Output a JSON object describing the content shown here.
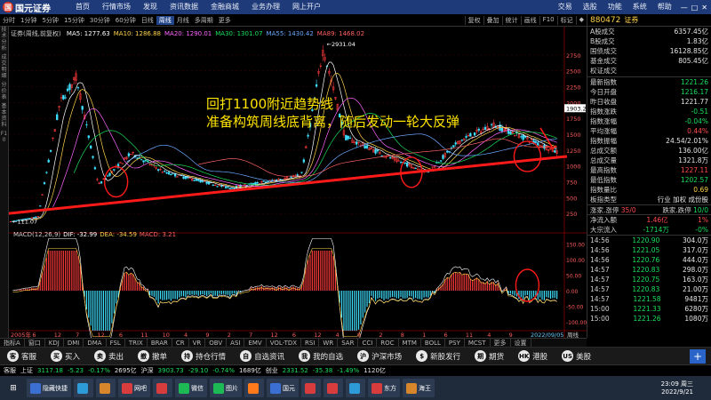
{
  "topbar": {
    "logo": "国元证券",
    "logo_mark": "国",
    "menu": [
      "首页",
      "行情市场",
      "发现",
      "资讯数据",
      "金融商城",
      "业务办理",
      "网上开户"
    ],
    "right_menu": [
      "交易",
      "选股",
      "功能",
      "系统",
      "帮助"
    ],
    "window_controls": [
      "—",
      "□",
      "✕"
    ]
  },
  "subbar": {
    "periods": [
      "分时",
      "1分钟",
      "5分钟",
      "15分钟",
      "30分钟",
      "60分钟",
      "日线",
      "周线",
      "月线",
      "多周期",
      "更多"
    ],
    "selected_period": "周线",
    "tools": [
      "复权",
      "叠加",
      "统计",
      "画线",
      "F10",
      "标记",
      "◆"
    ]
  },
  "left_strip": [
    "技术分析",
    "成交明细",
    "分价表",
    "基本资料",
    "F10"
  ],
  "chart": {
    "title": "证券(周线,前复权)",
    "ma_values": [
      {
        "label": "MA5: 1277.63",
        "color": "#ffffff"
      },
      {
        "label": "MA10: 1286.88",
        "color": "#ffd24a"
      },
      {
        "label": "MA20: 1290.01",
        "color": "#ff66ff"
      },
      {
        "label": "MA30: 1301.07",
        "color": "#18e05b"
      },
      {
        "label": "MA55: 1430.42",
        "color": "#6aa8ff"
      },
      {
        "label": "MA89: 1468.02",
        "color": "#ff6060"
      }
    ],
    "annotation_line1": "回打1100附近趋势线",
    "annotation_line2": "准备构筑周线底背离，随后发动一轮大反弹",
    "high_label": "2931.04",
    "low_label": "111.07",
    "current_value_label": "1903.2",
    "price_ticks": [
      "2750",
      "2500",
      "2250",
      "2000",
      "1750",
      "1500",
      "1250",
      "1000",
      "750",
      "500",
      "250"
    ],
    "macd_header": [
      {
        "label": "MACD(12,26,9)",
        "color": "#cccccc"
      },
      {
        "label": "DIF: -32.99",
        "color": "#ffffff"
      },
      {
        "label": "DEA: -34.59",
        "color": "#ffd24a"
      },
      {
        "label": "MACD: 3.21",
        "color": "#ff6060"
      }
    ],
    "macd_ticks": [
      "150.00",
      "100.00",
      "50.00",
      "0.00",
      "-50.00",
      "-100.00"
    ],
    "date_labels": [
      "2005年",
      "6",
      "12",
      "7",
      "12",
      "6",
      "11",
      "10",
      "4",
      "9",
      "2",
      "7",
      "12",
      "6",
      "12",
      "4",
      "9",
      "2",
      "8",
      "1",
      "6",
      "11",
      "4",
      "9",
      "2022/09/05"
    ],
    "indicator_label": "指标B",
    "week_label": "周线"
  },
  "bottom_tabs": [
    "指标A",
    "窗口",
    "KDJ",
    "DMI",
    "DMA",
    "FSL",
    "TRIX",
    "BRAR",
    "CR",
    "VR",
    "OBV",
    "ASI",
    "EMV",
    "VOL-TDX",
    "RSI",
    "WR",
    "SAR",
    "CCI",
    "ROC",
    "MTM",
    "BOLL",
    "PSY",
    "MCST",
    "更多",
    "设置"
  ],
  "right_panel": {
    "code": "880472",
    "name": "证券",
    "top_rows": [
      {
        "k": "A股成交",
        "v": "6357.45亿",
        "c": "white"
      },
      {
        "k": "B股成交",
        "v": "1.83亿",
        "c": "white"
      },
      {
        "k": "国债成交",
        "v": "16128.85亿",
        "c": "white"
      },
      {
        "k": "基金成交",
        "v": "805.45亿",
        "c": "white"
      },
      {
        "k": "权证成交",
        "v": "",
        "c": "white"
      }
    ],
    "stat_rows": [
      {
        "k": "最新指数",
        "v": "1221.26",
        "c": "green"
      },
      {
        "k": "今日开盘",
        "v": "1216.17",
        "c": "green"
      },
      {
        "k": "昨日收盘",
        "v": "1221.77",
        "c": "white"
      },
      {
        "k": "指数涨跌",
        "v": "-0.51",
        "c": "green"
      },
      {
        "k": "指数涨幅",
        "v": "-0.04%",
        "c": "green"
      },
      {
        "k": "平均涨幅",
        "v": "0.44%",
        "c": "red"
      },
      {
        "k": "指数振幅",
        "v": "24.54/2.01%",
        "c": "white"
      },
      {
        "k": "总成交额",
        "v": "136.00亿",
        "c": "white"
      },
      {
        "k": "总成交量",
        "v": "1321.8万",
        "c": "white"
      },
      {
        "k": "最高指数",
        "v": "1227.11",
        "c": "red"
      },
      {
        "k": "最低指数",
        "v": "1202.57",
        "c": "green"
      },
      {
        "k": "指数量比",
        "v": "0.69",
        "c": "yellow"
      }
    ],
    "category_row": {
      "k": "板指类型",
      "v": "行业 加权 成份股",
      "c": "white"
    },
    "updown": {
      "up_label": "涨家.涨停",
      "up": "35/0",
      "down_label": "跌家.跌停",
      "down": "10/0"
    },
    "inflow": [
      {
        "k": "净流入额",
        "v": "1.46亿",
        "p": "1%",
        "c": "red"
      },
      {
        "k": "大宗流入",
        "v": "-1714万",
        "p": "-0%",
        "c": "green"
      }
    ],
    "ticks": [
      {
        "t": "14:56",
        "p": "1220.90",
        "v": "304.0万",
        "c": "green"
      },
      {
        "t": "14:56",
        "p": "1221.05",
        "v": "317.0万",
        "c": "green"
      },
      {
        "t": "14:56",
        "p": "1220.76",
        "v": "444.0万",
        "c": "green"
      },
      {
        "t": "14:57",
        "p": "1220.83",
        "v": "298.0万",
        "c": "green"
      },
      {
        "t": "14:57",
        "p": "1220.75",
        "v": "163.0万",
        "c": "green"
      },
      {
        "t": "14:57",
        "p": "1220.83",
        "v": "21.00万",
        "c": "green"
      },
      {
        "t": "14:57",
        "p": "1221.58",
        "v": "9481万",
        "c": "green"
      },
      {
        "t": "15:00",
        "p": "1221.33",
        "v": "6280万",
        "c": "green"
      },
      {
        "t": "15:00",
        "p": "1221.26",
        "v": "1080万",
        "c": "green"
      }
    ]
  },
  "action_bar": {
    "left_items": [
      {
        "icon": "客",
        "label": "客服"
      },
      {
        "icon": "买",
        "label": "买入"
      },
      {
        "icon": "卖",
        "label": "卖出"
      },
      {
        "icon": "撤",
        "label": "撤单"
      },
      {
        "icon": "持",
        "label": "持仓行情"
      },
      {
        "icon": "自",
        "label": "自选资讯"
      },
      {
        "icon": "我",
        "label": "我的自选"
      },
      {
        "icon": "沪",
        "label": "沪深市场"
      },
      {
        "icon": "$",
        "label": "新股发行"
      },
      {
        "icon": "期",
        "label": "期货"
      },
      {
        "icon": "HK",
        "label": "港股"
      },
      {
        "icon": "US",
        "label": "美股"
      }
    ],
    "plus": "+"
  },
  "tickerbar": [
    {
      "t": "客服",
      "c": "white"
    },
    {
      "t": "上证",
      "c": "white"
    },
    {
      "t": "3117.18",
      "c": "green"
    },
    {
      "t": "-5.23",
      "c": "green"
    },
    {
      "t": "-0.17%",
      "c": "green"
    },
    {
      "t": "2695亿",
      "c": "white"
    },
    {
      "t": "沪深",
      "c": "white"
    },
    {
      "t": "3903.73",
      "c": "green"
    },
    {
      "t": "-29.10",
      "c": "green"
    },
    {
      "t": "-0.74%",
      "c": "green"
    },
    {
      "t": "1689亿",
      "c": "white"
    },
    {
      "t": "创业",
      "c": "white"
    },
    {
      "t": "2331.52",
      "c": "green"
    },
    {
      "t": "-35.38",
      "c": "green"
    },
    {
      "t": "-1.49%",
      "c": "green"
    },
    {
      "t": "1120亿",
      "c": "white"
    }
  ],
  "taskbar": {
    "items": [
      {
        "label": "隐藏快捷",
        "color": "#3b6fd1"
      },
      {
        "label": "",
        "color": "#2c9bd8"
      },
      {
        "label": "",
        "color": "#d8862c"
      },
      {
        "label": "网吧",
        "color": "#d83c3c"
      },
      {
        "label": "",
        "color": "#d83c3c"
      },
      {
        "label": "微信",
        "color": "#1db954"
      },
      {
        "label": "图片",
        "color": "#1db954"
      },
      {
        "label": "",
        "color": "#ff7a1a"
      },
      {
        "label": "国元",
        "color": "#3b6fd1"
      },
      {
        "label": "",
        "color": "#d83c3c"
      },
      {
        "label": "",
        "color": "#d83c3c"
      },
      {
        "label": "",
        "color": "#2c9bd8"
      },
      {
        "label": "东方",
        "color": "#d83c3c"
      },
      {
        "label": "海王",
        "color": "#d8862c"
      }
    ],
    "time": "23:09 周三",
    "date": "2022/9/21"
  }
}
